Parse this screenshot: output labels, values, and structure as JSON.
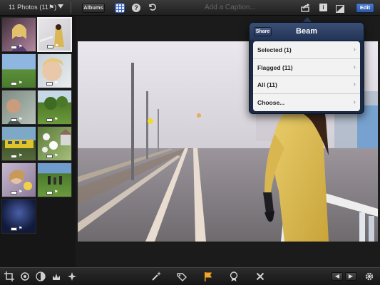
{
  "topbar": {
    "photos_count": "11 Photos (11⚑)",
    "albums_label": "Albums",
    "help_label": "?",
    "caption_placeholder": "Add a Caption...",
    "info_label": "i",
    "edit_label": "Edit",
    "icons": [
      "caret-down-icon",
      "grid-icon",
      "help-icon",
      "undo-icon",
      "share-icon",
      "info-icon",
      "compare-icon"
    ]
  },
  "thumbnails": {
    "count": 11,
    "selected_index": 1,
    "items": [
      {
        "name": "girl-smiling",
        "flagged": true
      },
      {
        "name": "girl-on-railing",
        "flagged": true
      },
      {
        "name": "field-landscape",
        "flagged": true
      },
      {
        "name": "child-portrait",
        "flagged": true
      },
      {
        "name": "profile-portrait",
        "flagged": true
      },
      {
        "name": "trees-meadow",
        "flagged": true
      },
      {
        "name": "yellow-train",
        "flagged": true
      },
      {
        "name": "white-flowers-house",
        "flagged": true
      },
      {
        "name": "girl-with-flowers",
        "flagged": true
      },
      {
        "name": "people-on-hill",
        "flagged": true
      },
      {
        "name": "night-crowd",
        "flagged": true
      }
    ]
  },
  "popover": {
    "share_label": "Share",
    "title": "Beam",
    "items": [
      {
        "label": "Selected (1)"
      },
      {
        "label": "Flagged (11)"
      },
      {
        "label": "All (11)"
      },
      {
        "label": "Choose..."
      }
    ],
    "chevron": "›"
  },
  "bottombar": {
    "left_tools": [
      "crop-icon",
      "rotate-icon",
      "exposure-icon",
      "color-icon",
      "effects-icon"
    ],
    "center_tools": [
      "wand-icon",
      "tag-icon",
      "flag-icon",
      "badge-icon",
      "delete-icon"
    ],
    "prev_label": "◀",
    "next_label": "▶",
    "settings_icon": "gear-icon"
  },
  "colors": {
    "accent": "#3d66b8",
    "popover_header": "#223557",
    "flag": "#f5a623"
  }
}
